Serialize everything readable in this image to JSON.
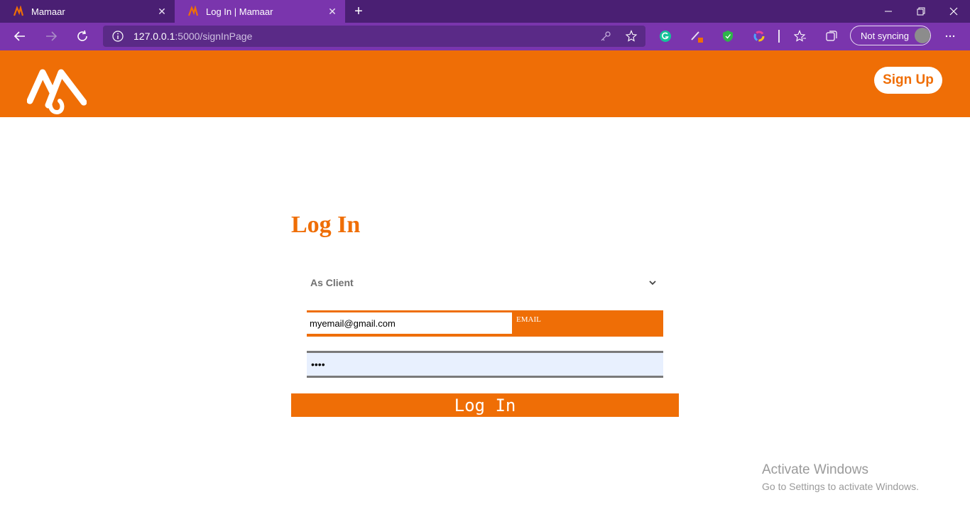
{
  "browser": {
    "tabs": [
      {
        "title": "Mamaar",
        "active": false
      },
      {
        "title": "Log In | Mamaar",
        "active": true
      }
    ],
    "url_host": "127.0.0.1",
    "url_path": ":5000/signInPage",
    "profile_label": "Not syncing",
    "new_tab_glyph": "+",
    "close_glyph": "✕"
  },
  "header": {
    "signup_label": "Sign Up",
    "logo": "mamaar-logo"
  },
  "form": {
    "title": "Log In",
    "role_selected": "As Client",
    "email_value": "myemail@gmail.com",
    "email_label": "EMAIL",
    "password_mask": "••••",
    "submit_label": "Log In"
  },
  "watermark": {
    "line1": "Activate Windows",
    "line2": "Go to Settings to activate Windows."
  },
  "colors": {
    "brand": "#ef6e06",
    "chrome_dark": "#4a1f73",
    "chrome": "#7a35ad"
  }
}
